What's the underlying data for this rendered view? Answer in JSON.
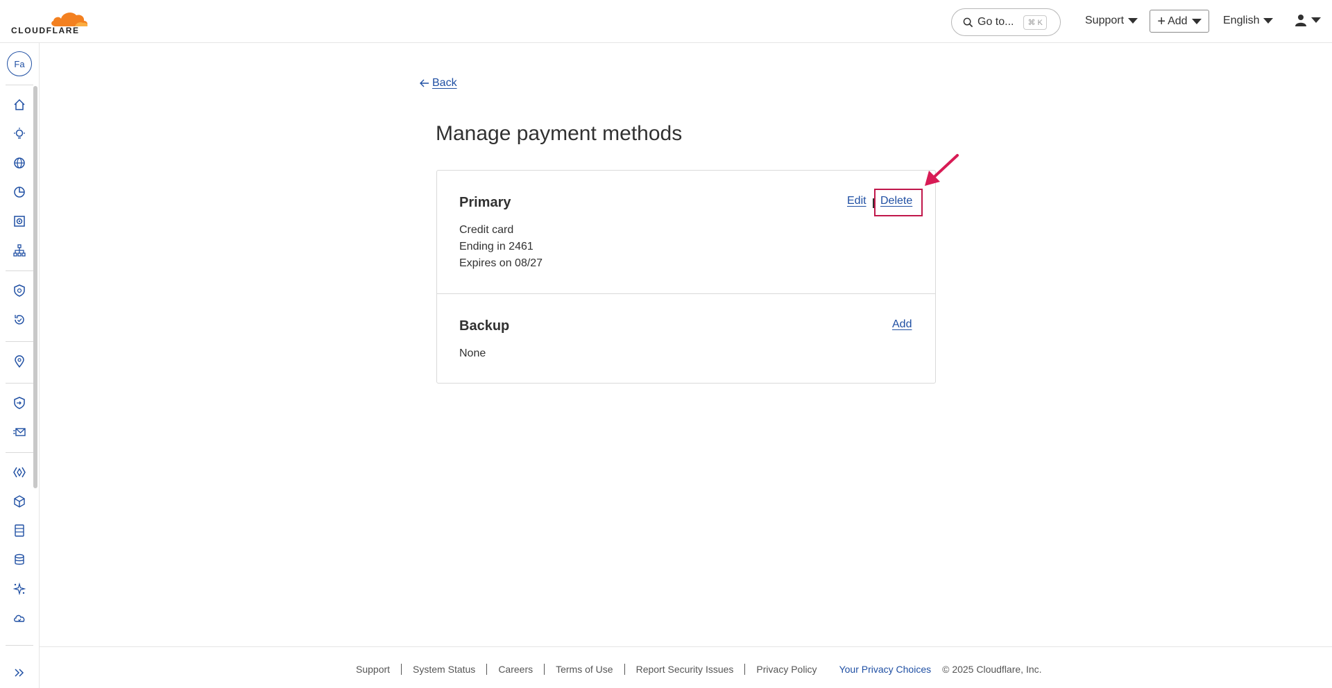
{
  "header": {
    "logo_text": "CLOUDFLARE",
    "goto_label": "Go to...",
    "goto_shortcut": "⌘ K",
    "support_label": "Support",
    "add_label": "Add",
    "language_label": "English"
  },
  "sidebar": {
    "account_initials": "Fa",
    "icons": [
      "home-icon",
      "lightbulb-icon",
      "globe-icon",
      "analytics-icon",
      "security-center-icon",
      "network-icon",
      "shield-icon",
      "history-icon",
      "location-icon",
      "zero-trust-icon",
      "email-icon",
      "workers-icon",
      "cube-icon",
      "storage-icon",
      "database-icon",
      "ai-icon",
      "cloud-icon"
    ]
  },
  "main": {
    "back_label": "Back",
    "title": "Manage payment methods",
    "primary": {
      "title": "Primary",
      "edit_label": "Edit",
      "delete_label": "Delete",
      "lines": [
        "Credit card",
        "Ending in 2461",
        "Expires on 08/27"
      ]
    },
    "backup": {
      "title": "Backup",
      "add_label": "Add",
      "value": "None"
    }
  },
  "footer": {
    "links": [
      "Support",
      "System Status",
      "Careers",
      "Terms of Use",
      "Report Security Issues",
      "Privacy Policy"
    ],
    "privacy_choices": "Your Privacy Choices",
    "copyright": "© 2025 Cloudflare, Inc."
  },
  "colors": {
    "link": "#1f4fa3",
    "highlight": "#c0174a",
    "brand_orange": "#f38020"
  }
}
